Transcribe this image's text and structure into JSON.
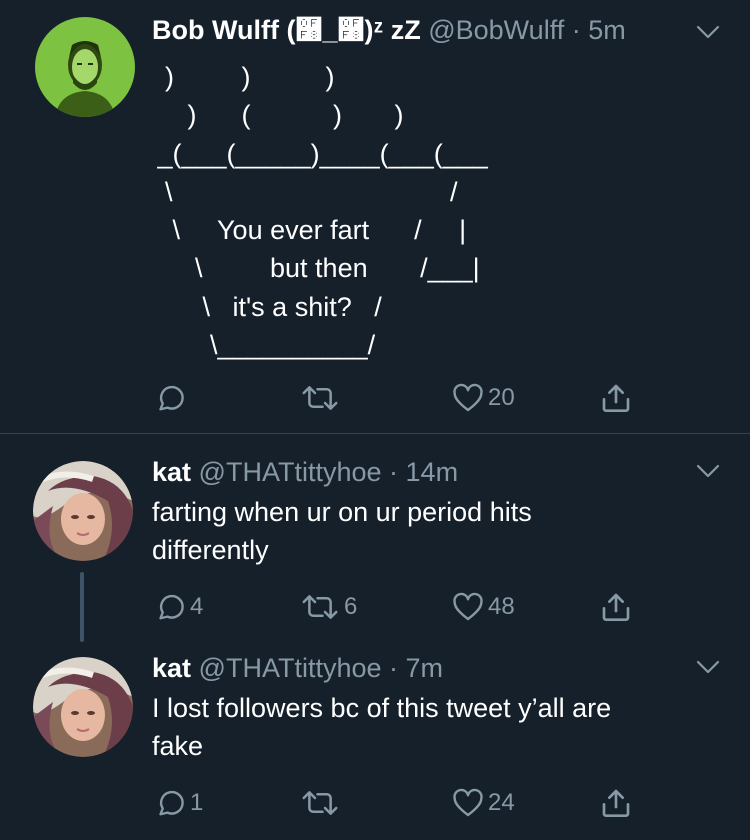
{
  "tweets": [
    {
      "name": "Bob Wulff (࿸_࿸)ᶻ zZ",
      "handle": "@BobWulff",
      "separator": "·",
      "time": "5m",
      "ascii_art": "  )         )          )\n     )      (           )       )\n _(___(_____)____(___(___\n  \\                                     /\n   \\     You ever fart      /     |\n      \\         but then       /___|\n       \\   it's a shit?   /\n        \\__________/",
      "actions": {
        "reply": "",
        "retweet": "",
        "like": "20"
      }
    },
    {
      "name": "kat",
      "handle": "@THATtittyhoe",
      "separator": "·",
      "time": "14m",
      "text": "farting when ur on ur period hits\ndifferently",
      "actions": {
        "reply": "4",
        "retweet": "6",
        "like": "48"
      }
    },
    {
      "name": "kat",
      "handle": "@THATtittyhoe",
      "separator": "·",
      "time": "7m",
      "text": "I lost followers bc of this tweet y’all are\nfake",
      "actions": {
        "reply": "1",
        "retweet": "",
        "like": "24"
      }
    }
  ],
  "icons": {
    "reply": "reply-icon",
    "retweet": "retweet-icon",
    "like": "heart-icon",
    "share": "share-icon",
    "more": "chevron-down-icon"
  },
  "colors": {
    "background": "#15202b",
    "text": "#ffffff",
    "secondary": "#8899a6",
    "divider": "#38444d",
    "thread_line": "#3d5466",
    "avatar_bob": "#7ec242"
  }
}
